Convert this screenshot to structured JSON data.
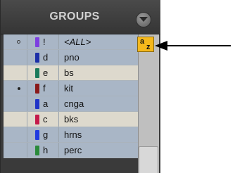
{
  "header": {
    "title": "GROUPS",
    "menu_icon": "triangle-down-icon"
  },
  "sort_button": {
    "label_a": "a",
    "label_z": "z",
    "icon": "alpha-sort-icon",
    "color": "#f5b81c"
  },
  "rows": [
    {
      "mark": "hollow",
      "color": "#7d3fe0",
      "id": "!",
      "name": "<ALL>",
      "italic": true,
      "bg": "cool"
    },
    {
      "mark": "none",
      "color": "#1c2fa8",
      "id": "d",
      "name": "pno",
      "italic": false,
      "bg": "cool"
    },
    {
      "mark": "none",
      "color": "#1a7a5a",
      "id": "e",
      "name": "bs",
      "italic": false,
      "bg": "warm"
    },
    {
      "mark": "solid",
      "color": "#8a1a1a",
      "id": "f",
      "name": "kit",
      "italic": false,
      "bg": "cool"
    },
    {
      "mark": "none",
      "color": "#1f34c8",
      "id": "a",
      "name": "cnga",
      "italic": false,
      "bg": "cool"
    },
    {
      "mark": "none",
      "color": "#c41a4a",
      "id": "c",
      "name": "bks",
      "italic": false,
      "bg": "warm"
    },
    {
      "mark": "none",
      "color": "#1f3ae0",
      "id": "g",
      "name": "hrns",
      "italic": false,
      "bg": "cool"
    },
    {
      "mark": "none",
      "color": "#2a8a3a",
      "id": "h",
      "name": "perc",
      "italic": false,
      "bg": "cool"
    }
  ]
}
